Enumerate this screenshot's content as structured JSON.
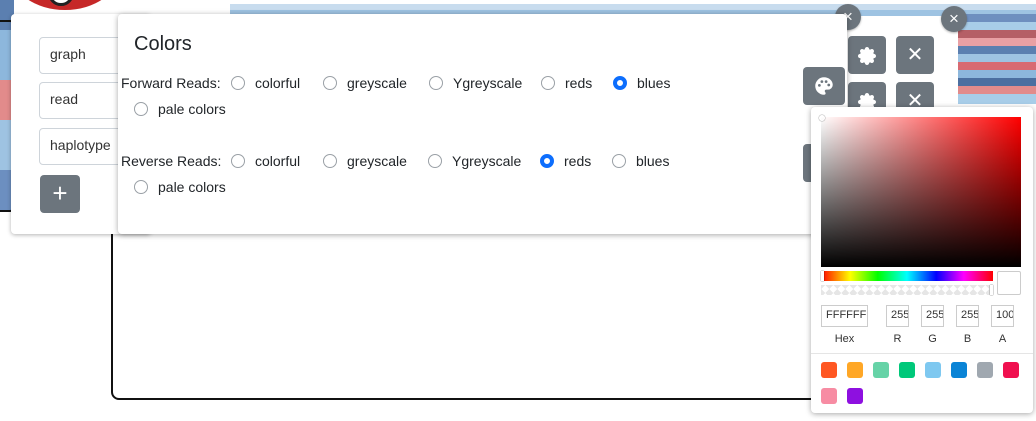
{
  "tracks": {
    "inputs": [
      "graph",
      "read",
      "haplotype"
    ],
    "add_label": "+"
  },
  "colors_dialog": {
    "title": "Colors",
    "forward_label": "Forward Reads:",
    "reverse_label": "Reverse Reads:",
    "options": [
      "colorful",
      "greyscale",
      "Ygreyscale",
      "reds",
      "blues",
      "pale colors"
    ],
    "forward_selected": "blues",
    "reverse_selected": "reds"
  },
  "controls": {
    "close_symbol": "×",
    "remove_symbol": "✕"
  },
  "picker": {
    "hex_value": "FFFFFF",
    "r_value": "255",
    "g_value": "255",
    "b_value": "255",
    "a_value": "100",
    "hex_label": "Hex",
    "r_label": "R",
    "g_label": "G",
    "b_label": "B",
    "a_label": "A",
    "presets": [
      "#ff5722",
      "#ffa726",
      "#66d3a7",
      "#00c87a",
      "#7ec8f0",
      "#0a84d6",
      "#a0a8b0",
      "#f0104f",
      "#f78ca3",
      "#8e10e0"
    ]
  },
  "colors": {
    "accent": "#0d6efd",
    "button": "#6c757d"
  }
}
